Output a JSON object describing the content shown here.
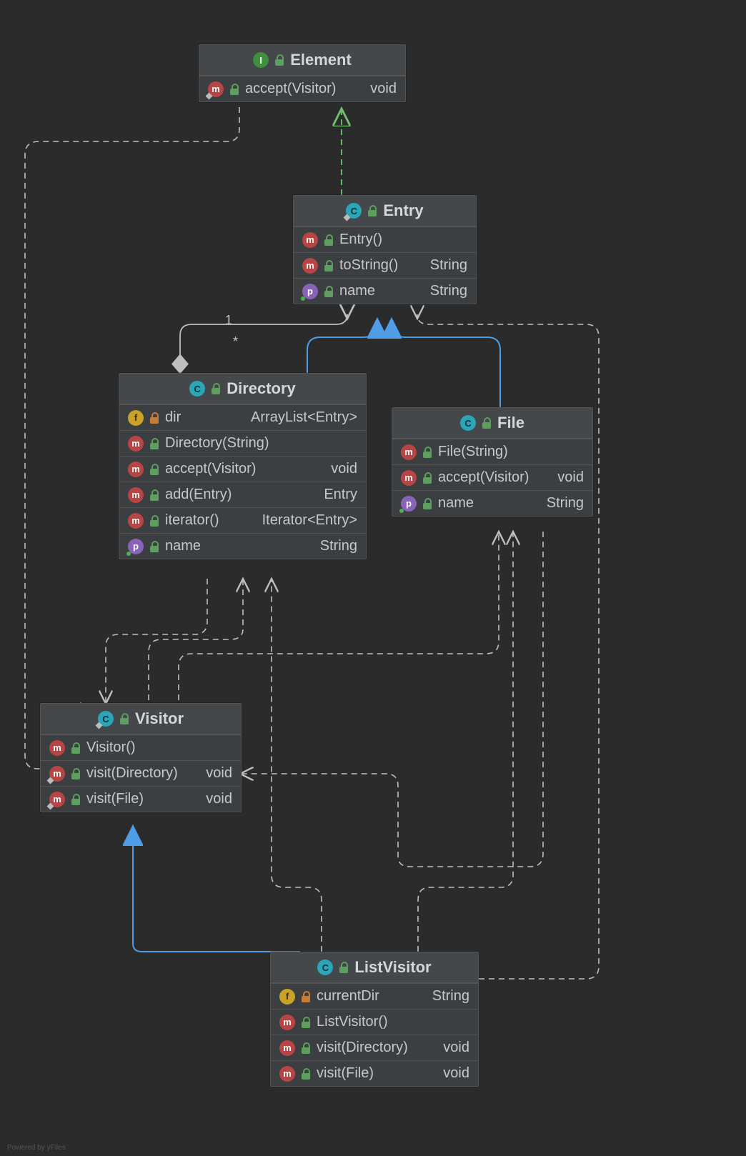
{
  "diagram": {
    "footer": "Powered by yFiles",
    "multiplicity": {
      "one": "1",
      "many": "*"
    },
    "classes": {
      "element": {
        "kind": "I",
        "name": "Element",
        "rows": [
          {
            "badge": "m",
            "abs": true,
            "vis": "public",
            "name": "accept(Visitor)",
            "type": "void"
          }
        ]
      },
      "entry": {
        "kind": "C",
        "abs": true,
        "name": "Entry",
        "rows": [
          {
            "badge": "m",
            "vis": "public",
            "name": "Entry()",
            "type": ""
          },
          {
            "badge": "m",
            "vis": "public",
            "name": "toString()",
            "type": "String"
          },
          {
            "badge": "p",
            "vis": "public",
            "name": "name",
            "type": "String"
          }
        ]
      },
      "directory": {
        "kind": "C",
        "name": "Directory",
        "rows": [
          {
            "badge": "f",
            "vis": "private",
            "name": "dir",
            "type": "ArrayList<Entry>"
          },
          {
            "badge": "m",
            "vis": "public",
            "name": "Directory(String)",
            "type": ""
          },
          {
            "badge": "m",
            "vis": "public",
            "name": "accept(Visitor)",
            "type": "void"
          },
          {
            "badge": "m",
            "vis": "public",
            "name": "add(Entry)",
            "type": "Entry"
          },
          {
            "badge": "m",
            "vis": "public",
            "name": "iterator()",
            "type": "Iterator<Entry>"
          },
          {
            "badge": "p",
            "vis": "public",
            "name": "name",
            "type": "String"
          }
        ]
      },
      "file": {
        "kind": "C",
        "name": "File",
        "rows": [
          {
            "badge": "m",
            "vis": "public",
            "name": "File(String)",
            "type": ""
          },
          {
            "badge": "m",
            "vis": "public",
            "name": "accept(Visitor)",
            "type": "void"
          },
          {
            "badge": "p",
            "vis": "public",
            "name": "name",
            "type": "String"
          }
        ]
      },
      "visitor": {
        "kind": "C",
        "abs": true,
        "name": "Visitor",
        "rows": [
          {
            "badge": "m",
            "vis": "public",
            "name": "Visitor()",
            "type": ""
          },
          {
            "badge": "m",
            "abs": true,
            "vis": "public",
            "name": "visit(Directory)",
            "type": "void"
          },
          {
            "badge": "m",
            "abs": true,
            "vis": "public",
            "name": "visit(File)",
            "type": "void"
          }
        ]
      },
      "listvisitor": {
        "kind": "C",
        "name": "ListVisitor",
        "rows": [
          {
            "badge": "f",
            "vis": "private",
            "name": "currentDir",
            "type": "String"
          },
          {
            "badge": "m",
            "vis": "public",
            "name": "ListVisitor()",
            "type": ""
          },
          {
            "badge": "m",
            "vis": "public",
            "name": "visit(Directory)",
            "type": "void"
          },
          {
            "badge": "m",
            "vis": "public",
            "name": "visit(File)",
            "type": "void"
          }
        ]
      }
    },
    "relationships": [
      {
        "from": "Entry",
        "to": "Element",
        "type": "realization"
      },
      {
        "from": "Directory",
        "to": "Entry",
        "type": "generalization"
      },
      {
        "from": "File",
        "to": "Entry",
        "type": "generalization"
      },
      {
        "from": "ListVisitor",
        "to": "Visitor",
        "type": "generalization"
      },
      {
        "from": "Directory",
        "to": "Entry",
        "type": "aggregation",
        "fromMult": "1",
        "toMult": "*"
      },
      {
        "from": "Element",
        "to": "Visitor",
        "type": "dependency"
      },
      {
        "from": "Visitor",
        "to": "Directory",
        "type": "dependency"
      },
      {
        "from": "Visitor",
        "to": "File",
        "type": "dependency"
      },
      {
        "from": "Directory",
        "to": "Visitor",
        "type": "dependency"
      },
      {
        "from": "File",
        "to": "Visitor",
        "type": "dependency"
      },
      {
        "from": "ListVisitor",
        "to": "Directory",
        "type": "dependency"
      },
      {
        "from": "ListVisitor",
        "to": "File",
        "type": "dependency"
      },
      {
        "from": "ListVisitor",
        "to": "Entry",
        "type": "dependency"
      }
    ]
  }
}
